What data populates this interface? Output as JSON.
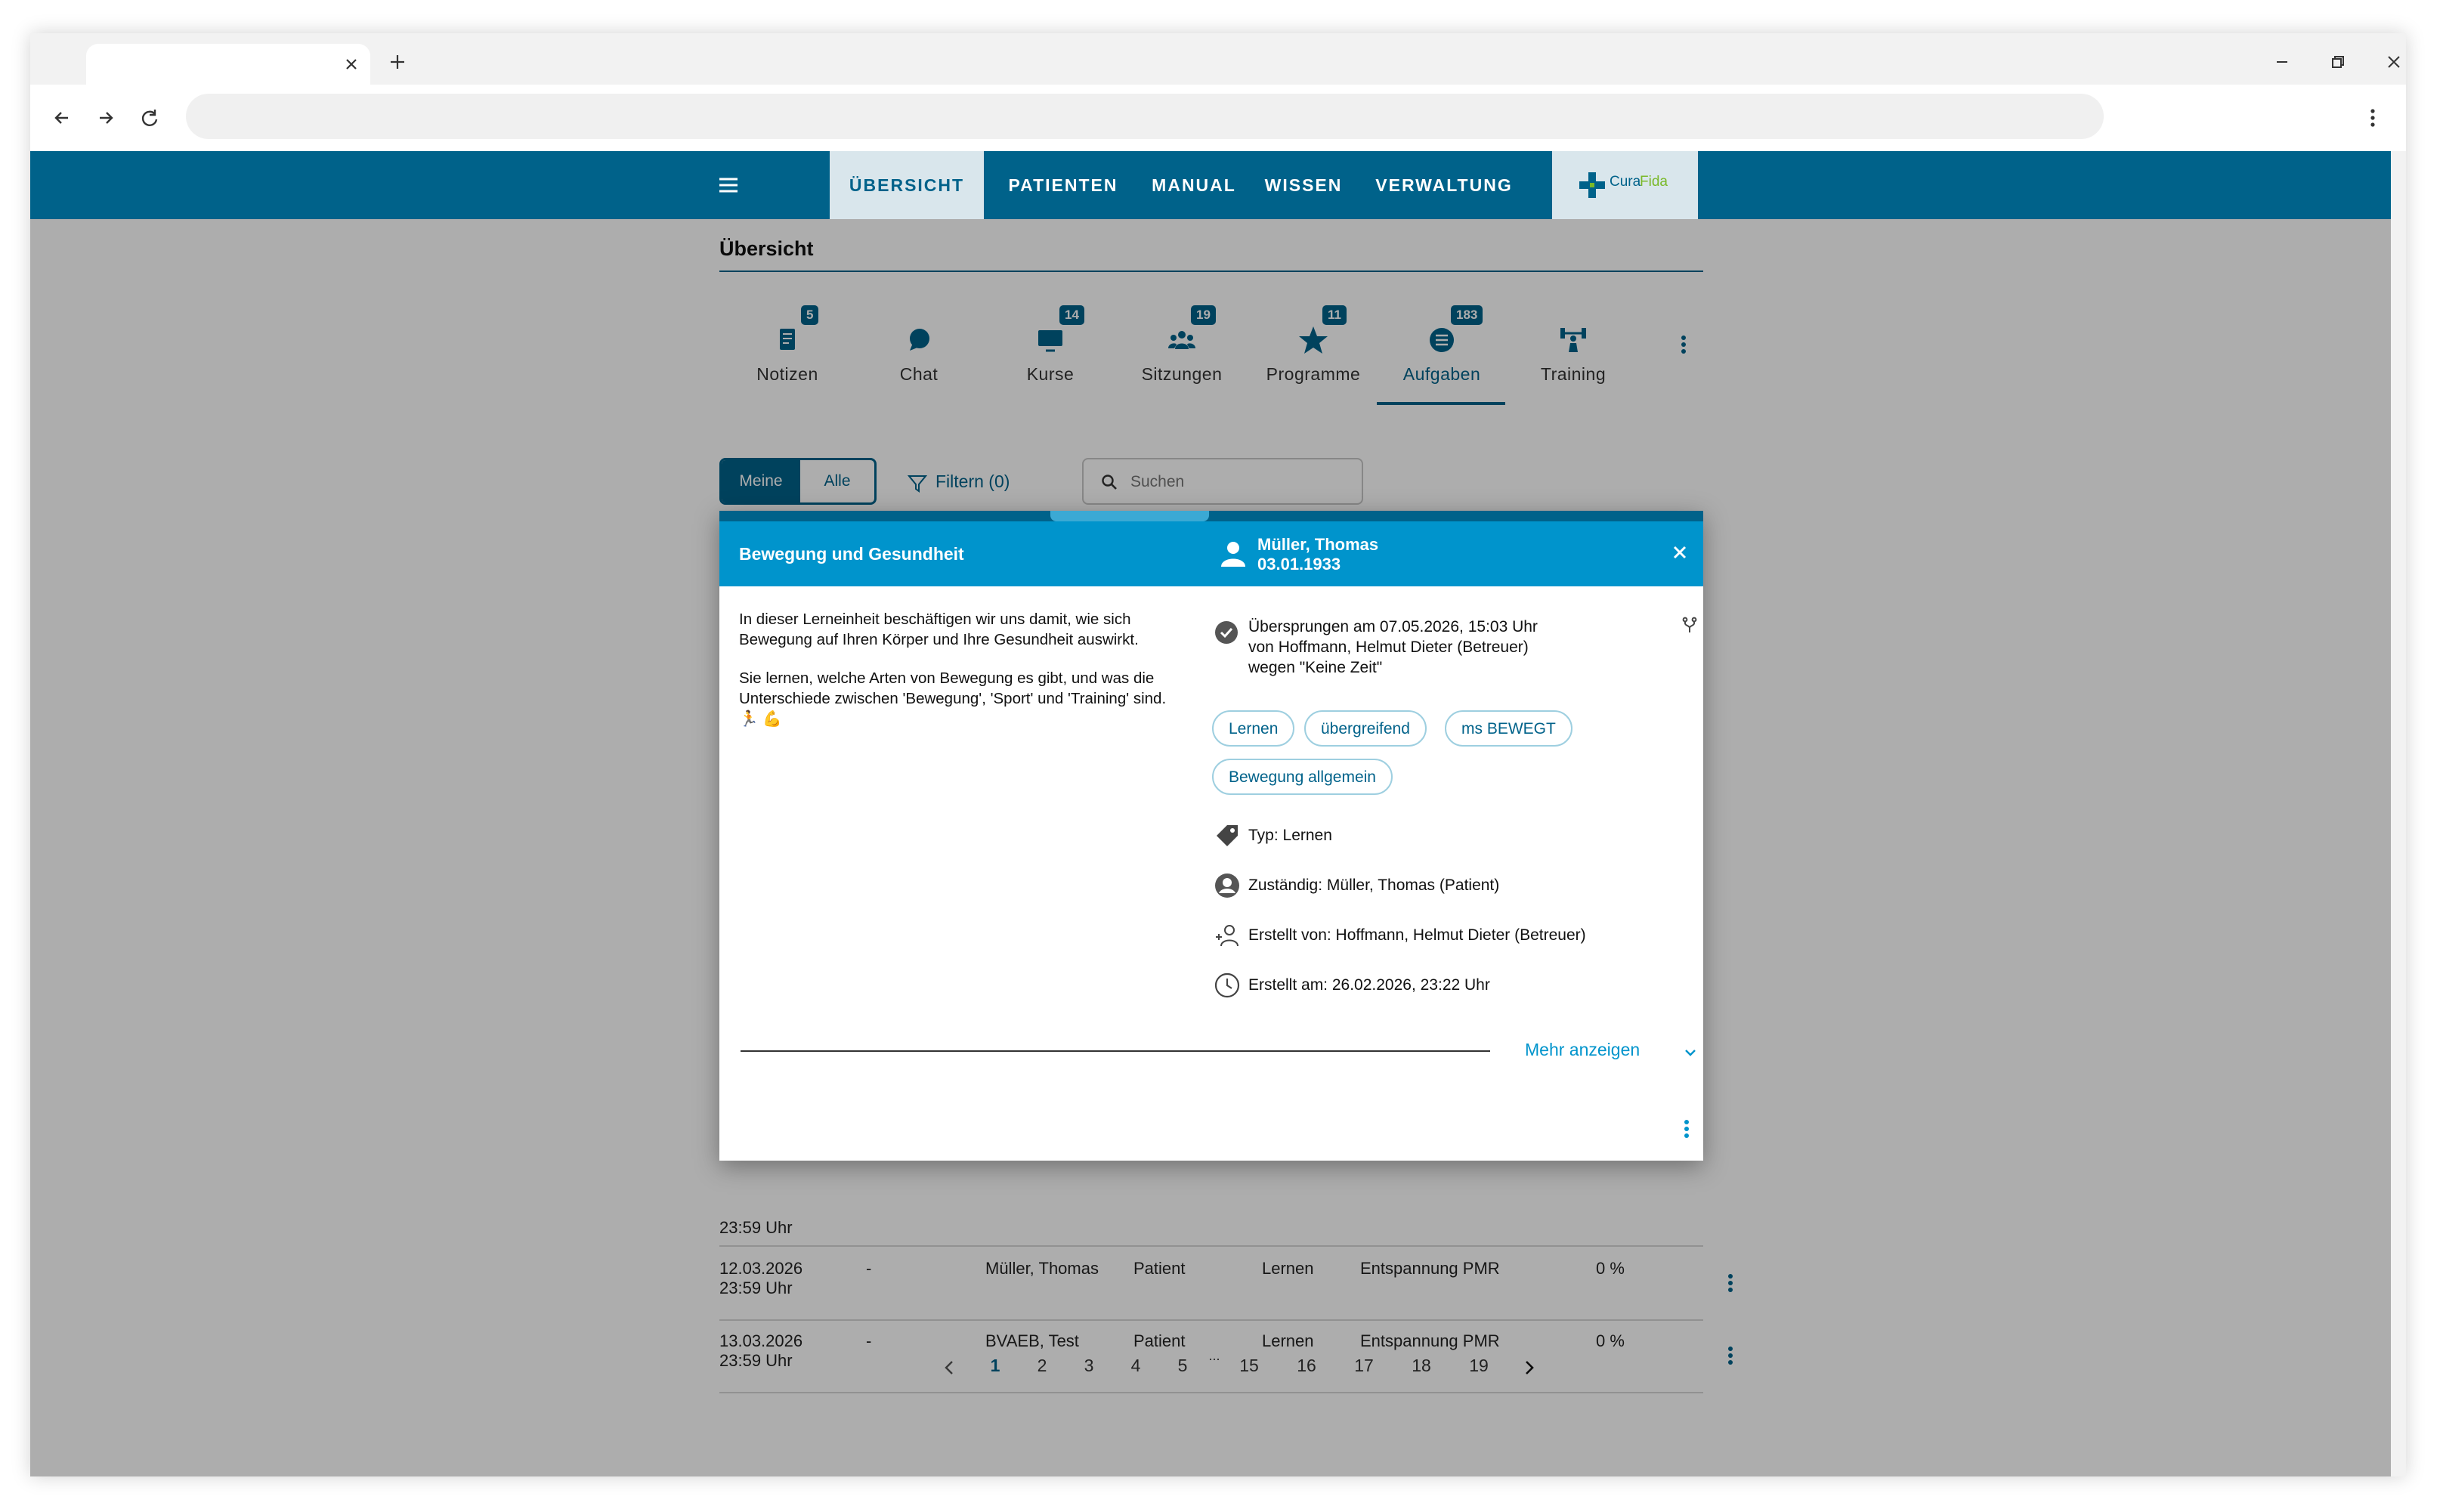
{
  "browser": {
    "tab_title": "",
    "url": ""
  },
  "appbar": {
    "nav_tabs": [
      {
        "label": "ÜBERSICHT"
      },
      {
        "label": "PATIENTEN"
      },
      {
        "label": "MANUAL"
      },
      {
        "label": "WISSEN"
      },
      {
        "label": "VERWALTUNG"
      }
    ],
    "logo_text_a": "Cura",
    "logo_text_b": "Fida"
  },
  "page": {
    "title": "Übersicht"
  },
  "categories": [
    {
      "label": "Notizen",
      "badge": "5",
      "icon": "note-icon"
    },
    {
      "label": "Chat",
      "badge": "",
      "icon": "chat-icon"
    },
    {
      "label": "Kurse",
      "badge": "14",
      "icon": "monitor-icon"
    },
    {
      "label": "Sitzungen",
      "badge": "19",
      "icon": "group-icon"
    },
    {
      "label": "Programme",
      "badge": "11",
      "icon": "star-icon"
    },
    {
      "label": "Aufgaben",
      "badge": "183",
      "icon": "list-icon"
    },
    {
      "label": "Training",
      "badge": "",
      "icon": "fitness-icon"
    }
  ],
  "filters": {
    "scope_mine": "Meine",
    "scope_all": "Alle",
    "filter_label": "Filtern (0)",
    "search_placeholder": "Suchen"
  },
  "table": {
    "partial_row_text": "23:59 Uhr",
    "rows": [
      {
        "date": "12.03.2026",
        "time": "23:59 Uhr",
        "dash": "-",
        "person": "Müller, Thomas",
        "role": "Patient",
        "type": "Lernen",
        "program": "Entspannung PMR",
        "progress": "0 %"
      },
      {
        "date": "13.03.2026",
        "time": "23:59 Uhr",
        "dash": "-",
        "person": "BVAEB, Test",
        "role": "Patient",
        "type": "Lernen",
        "program": "Entspannung PMR",
        "progress": "0 %"
      }
    ]
  },
  "pagination": {
    "pages": [
      "1",
      "2",
      "3",
      "4",
      "5",
      "15",
      "16",
      "17",
      "18",
      "19"
    ],
    "ellipsis": "...",
    "current": 1
  },
  "dialog": {
    "title": "Bewegung und Gesundheit",
    "patient_name": "Müller, Thomas",
    "patient_dob": "03.01.1933",
    "description_p1": "In dieser Lerneinheit beschäftigen wir uns damit, wie sich Bewegung auf Ihren Körper und Ihre Gesundheit auswirkt.",
    "description_p2": "Sie lernen, welche Arten von Bewegung es gibt, und was die Unterschiede zwischen 'Bewegung', 'Sport' und 'Training' sind. 🏃 💪",
    "status_line1": "Übersprungen am 07.05.2026, 15:03 Uhr",
    "status_line2": "von Hoffmann, Helmut Dieter (Betreuer)",
    "status_line3": "wegen \"Keine Zeit\"",
    "tags": [
      "Lernen",
      "übergreifend",
      "ms BEWEGT",
      "Bewegung allgemein"
    ],
    "meta": {
      "type": "Typ: Lernen",
      "responsible": "Zuständig: Müller, Thomas (Patient)",
      "created_by": "Erstellt von: Hoffmann, Helmut Dieter (Betreuer)",
      "created_at": "Erstellt am: 26.02.2026, 23:22 Uhr"
    },
    "show_more": "Mehr anzeigen"
  },
  "colors": {
    "primary": "#00628a",
    "accent": "#0094cc",
    "logo_green": "#7ab929"
  }
}
